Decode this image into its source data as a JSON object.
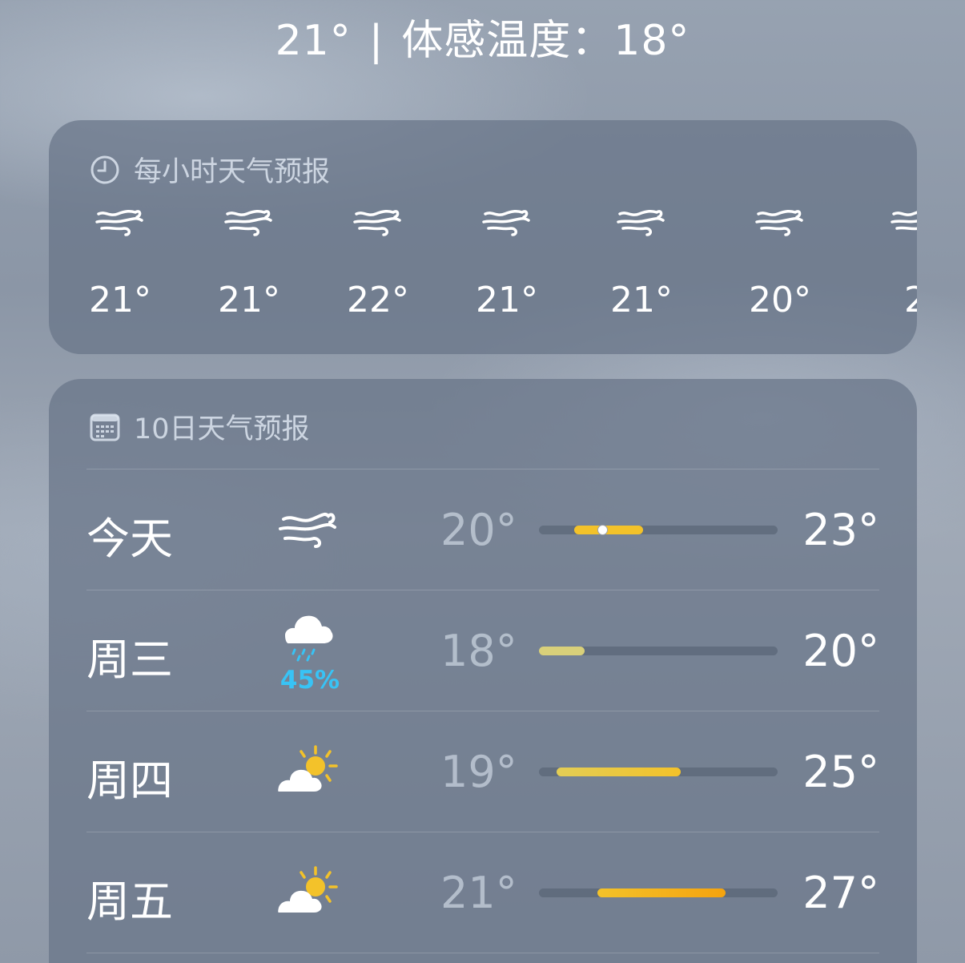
{
  "current": {
    "temp": "21°",
    "separator": "|",
    "feels_like": "体感温度：18°"
  },
  "hourly": {
    "title": "每小时天气预报",
    "header_icon": "clock-icon",
    "items": [
      {
        "icon": "wind-icon",
        "temp": "21°"
      },
      {
        "icon": "wind-icon",
        "temp": "21°"
      },
      {
        "icon": "wind-icon",
        "temp": "22°"
      },
      {
        "icon": "wind-icon",
        "temp": "21°"
      },
      {
        "icon": "wind-icon",
        "temp": "21°"
      },
      {
        "icon": "wind-icon",
        "temp": "20°"
      },
      {
        "icon": "wind-icon",
        "temp": "2"
      }
    ]
  },
  "daily": {
    "title": "10日天气预报",
    "header_icon": "calendar-icon",
    "days": [
      {
        "day": "今天",
        "icon": "wind-icon",
        "low": "20°",
        "high": "23°",
        "precip": ""
      },
      {
        "day": "周三",
        "icon": "cloud-rain-icon",
        "low": "18°",
        "high": "20°",
        "precip": "45%"
      },
      {
        "day": "周四",
        "icon": "cloud-sun-icon",
        "low": "19°",
        "high": "25°",
        "precip": ""
      },
      {
        "day": "周五",
        "icon": "cloud-sun-icon",
        "low": "21°",
        "high": "27°",
        "precip": ""
      }
    ],
    "range_colors": {
      "yellow": "#f3c22a",
      "pale_yellow": "#d9d07a",
      "orange": "#f4a30f"
    }
  }
}
